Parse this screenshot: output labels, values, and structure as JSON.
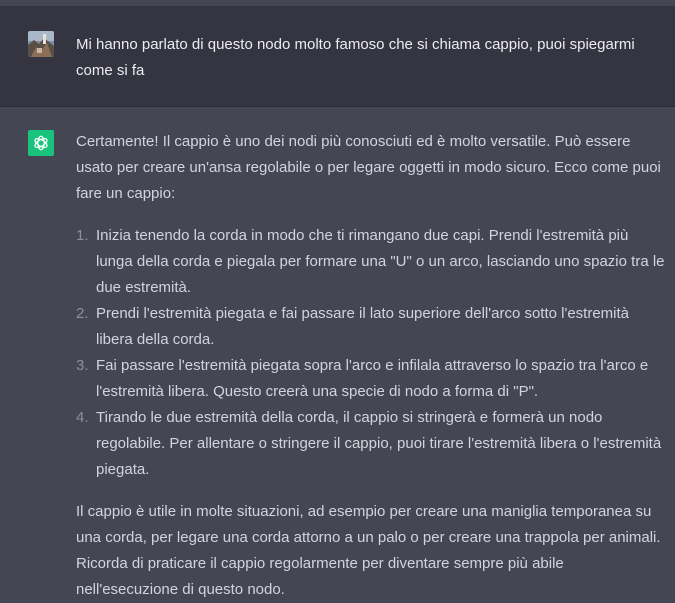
{
  "user_message": {
    "avatar_icon": "user-photo-avatar",
    "text": "Mi hanno parlato di questo nodo molto famoso che si chiama cappio, puoi spiegarmi come si fa"
  },
  "assistant_message": {
    "avatar_icon": "openai-logo-icon",
    "avatar_color": "#19c37d",
    "intro": "Certamente! Il cappio è uno dei nodi più conosciuti ed è molto versatile. Può essere usato per creare un'ansa regolabile o per legare oggetti in modo sicuro. Ecco come puoi fare un cappio:",
    "steps": [
      {
        "number": "1.",
        "text": "Inizia tenendo la corda in modo che ti rimangano due capi. Prendi l'estremità più lunga della corda e piegala per formare una \"U\" o un arco, lasciando uno spazio tra le due estremità."
      },
      {
        "number": "2.",
        "text": "Prendi l'estremità piegata e fai passare il lato superiore dell'arco sotto l'estremità libera della corda."
      },
      {
        "number": "3.",
        "text": "Fai passare l'estremità piegata sopra l'arco e infilala attraverso lo spazio tra l'arco e l'estremità libera. Questo creerà una specie di nodo a forma di \"P\"."
      },
      {
        "number": "4.",
        "text": "Tirando le due estremità della corda, il cappio si stringerà e formerà un nodo regolabile. Per allentare o stringere il cappio, puoi tirare l'estremità libera o l'estremità piegata."
      }
    ],
    "outro": "Il cappio è utile in molte situazioni, ad esempio per creare una maniglia temporanea su una corda, per legare una corda attorno a un palo o per creare una trappola per animali. Ricorda di praticare il cappio regolarmente per diventare sempre più abile nell'esecuzione di questo nodo."
  }
}
